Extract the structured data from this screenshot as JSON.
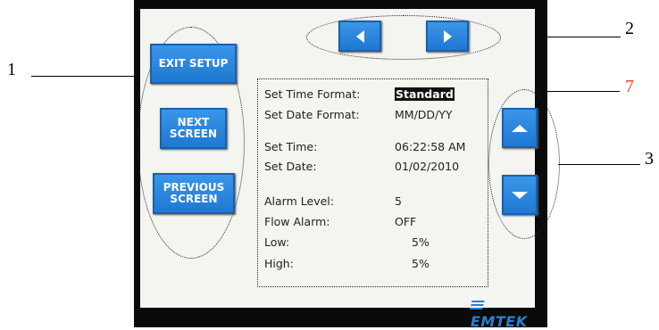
{
  "callouts": {
    "one": "1",
    "two": "2",
    "three": "3",
    "seven": "7"
  },
  "buttons": {
    "exit_setup": "EXIT SETUP",
    "next_screen": [
      "NEXT",
      "SCREEN"
    ],
    "previous_screen": [
      "PREVIOUS",
      "SCREEN"
    ]
  },
  "settings": [
    {
      "label": "Set Time Format:",
      "value": "Standard"
    },
    {
      "label": "Set Date Format:",
      "value": "MM/DD/YY"
    },
    {
      "label": "Set Time:",
      "value": "06:22:58 AM"
    },
    {
      "label": "Set Date:",
      "value": "01/02/2010"
    },
    {
      "label": "Alarm Level:",
      "value": "5"
    },
    {
      "label": "Flow Alarm:",
      "value": "OFF"
    },
    {
      "label": "Low:",
      "value": "5%"
    },
    {
      "label": "High:",
      "value": "5%"
    }
  ],
  "brand": "EMTEK",
  "colors": {
    "button_blue": "#1f78d2",
    "callout_red": "#e0452c",
    "logo_blue": "#2a7fd0"
  },
  "icons": [
    "arrow-left-icon",
    "arrow-right-icon",
    "arrow-up-icon",
    "arrow-down-icon"
  ]
}
